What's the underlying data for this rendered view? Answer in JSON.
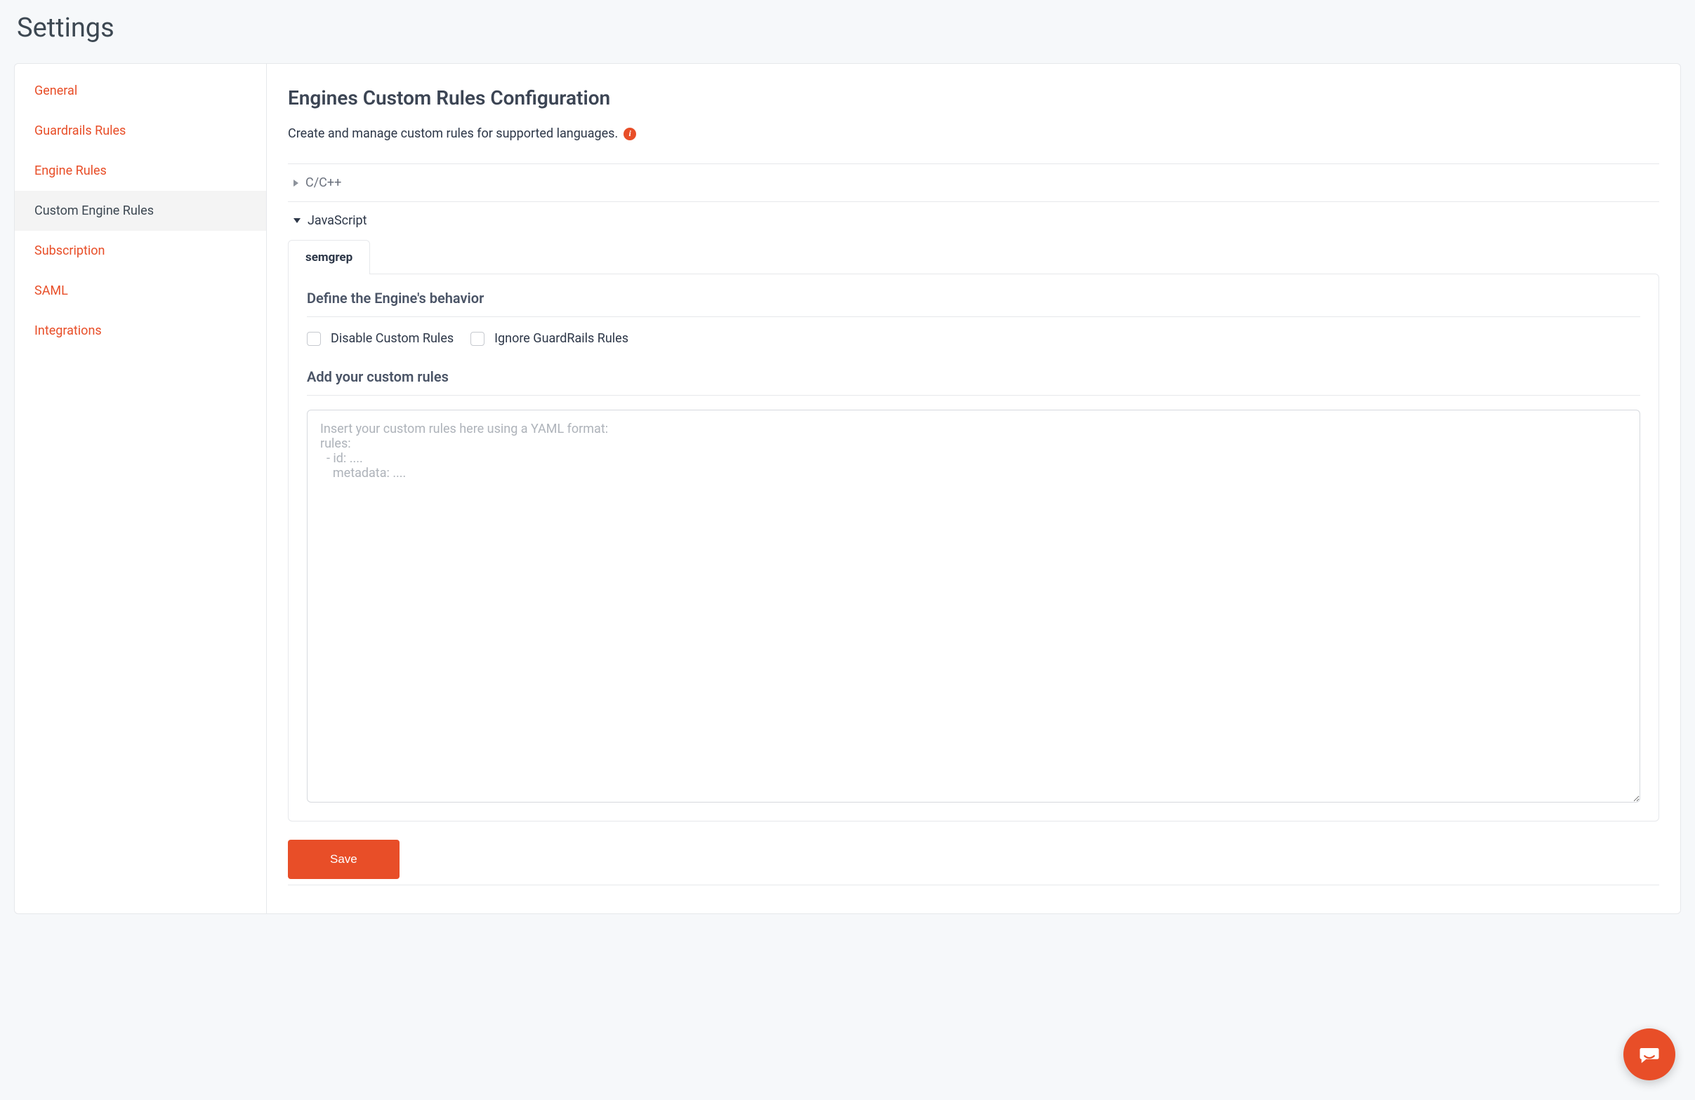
{
  "pageTitle": "Settings",
  "sidebar": {
    "items": [
      {
        "label": "General",
        "active": false
      },
      {
        "label": "Guardrails Rules",
        "active": false
      },
      {
        "label": "Engine Rules",
        "active": false
      },
      {
        "label": "Custom Engine Rules",
        "active": true
      },
      {
        "label": "Subscription",
        "active": false
      },
      {
        "label": "SAML",
        "active": false
      },
      {
        "label": "Integrations",
        "active": false
      }
    ]
  },
  "main": {
    "heading": "Engines Custom Rules Configuration",
    "subtitle": "Create and manage custom rules for supported languages.",
    "accordion": [
      {
        "label": "C/C++",
        "expanded": false
      },
      {
        "label": "JavaScript",
        "expanded": true
      }
    ],
    "activeTab": "semgrep",
    "panel": {
      "defineHeading": "Define the Engine's behavior",
      "disableLabel": "Disable Custom Rules",
      "ignoreLabel": "Ignore GuardRails Rules",
      "addRulesHeading": "Add your custom rules",
      "placeholder": "Insert your custom rules here using a YAML format:\nrules:\n  - id: ....\n    metadata: ....",
      "rulesValue": ""
    },
    "saveLabel": "Save"
  }
}
